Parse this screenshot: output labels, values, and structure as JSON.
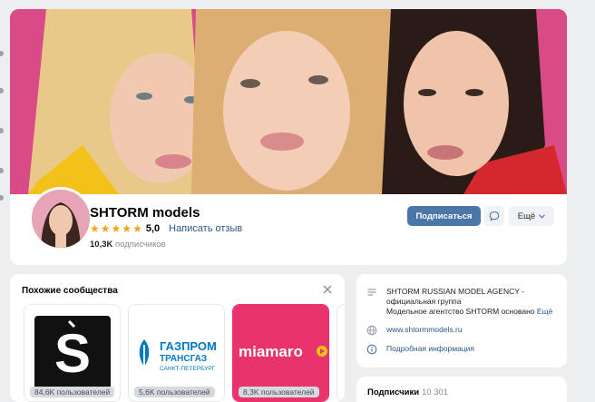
{
  "group": {
    "name": "SHTORM models",
    "rating": "5,0",
    "stars": 5,
    "review_link": "Написать отзыв",
    "subscribers_count": "10,3K",
    "subscribers_word": "подписчиков"
  },
  "actions": {
    "subscribe": "Подписаться",
    "more": "Ещё"
  },
  "similar": {
    "title": "Похожие сообщества",
    "items": [
      {
        "logo_text": "S",
        "badge": "84,6K пользователей"
      },
      {
        "logo_text_main": "ГАЗПРОМ",
        "logo_text_sub": "ТРАНСГАЗ",
        "logo_text_city": "САНКТ-ПЕТЕРБУРГ",
        "badge": "5,6K пользователей"
      },
      {
        "logo_text": "miamaro",
        "badge": "8,3K пользователей"
      }
    ]
  },
  "info": {
    "description_title": "SHTORM RUSSIAN MODEL AGENCY -",
    "description_type": "официальная группа",
    "description_more": "Модельное агентство SHTORM основано",
    "more_link": "Ещё",
    "website": "www.shtormmodels.ru",
    "details_link": "Подробная информация"
  },
  "subscribers_block": {
    "label": "Подписчики",
    "count": "10 301"
  },
  "colors": {
    "accent": "#4a76a8",
    "link": "#2a5885",
    "star": "#f8a01c",
    "cover_bg": "#d94b86",
    "miamaro_bg": "#e8336d",
    "gazprom_blue": "#0079c2"
  }
}
